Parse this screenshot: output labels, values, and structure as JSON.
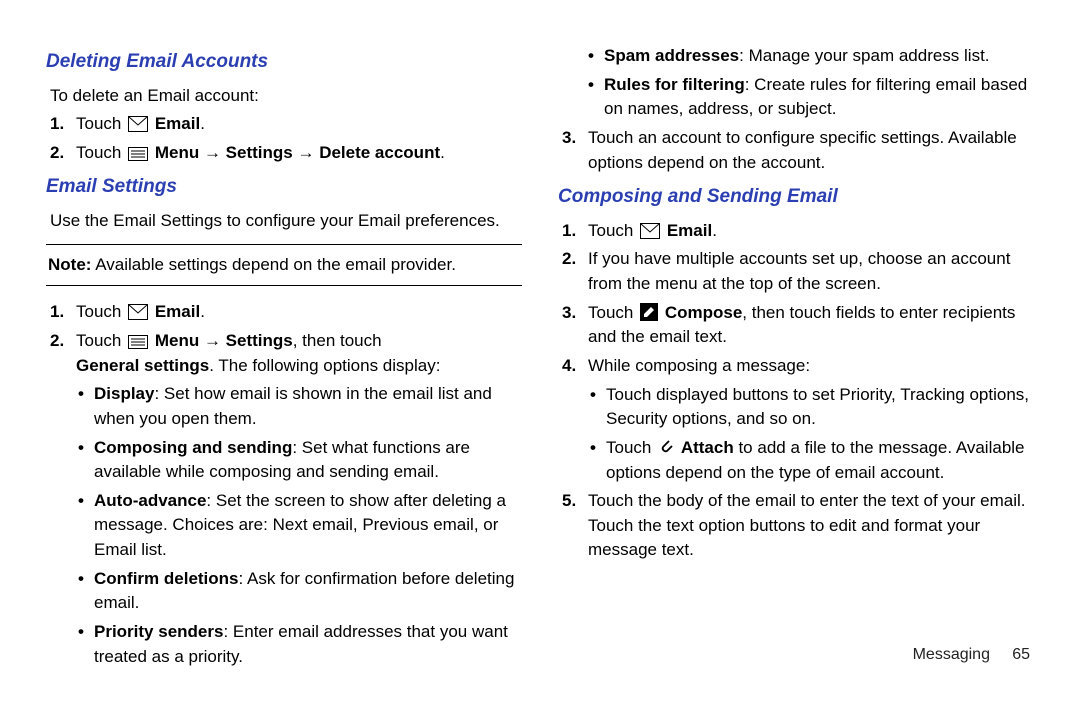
{
  "footer": {
    "section": "Messaging",
    "page": "65"
  },
  "left": {
    "h1": "Deleting Email Accounts",
    "intro1": "To delete an Email account:",
    "s1_touch": "Touch ",
    "s1_email": "Email",
    "s1_dot": ".",
    "s2_touch": "Touch ",
    "s2_menu": "Menu",
    "s2_settings": "Settings",
    "s2_delete": "Delete account",
    "s2_dot": ".",
    "h2": "Email Settings",
    "intro2": "Use the Email Settings to configure your Email preferences.",
    "note_b": "Note:",
    "note_t": " Available settings depend on the email provider.",
    "s3_touch": "Touch ",
    "s3_email": "Email",
    "s3_dot": ".",
    "s4_touch": "Touch ",
    "s4_menu": "Menu",
    "s4_settings": "Settings",
    "s4_then": ", then touch ",
    "s4_general": "General settings",
    "s4_rest": ". The following options display:",
    "b_display_b": "Display",
    "b_display_t": ": Set how email is shown in the email list and when you open them.",
    "b_comp_b": "Composing and sending",
    "b_comp_t": ": Set what functions are available while composing and sending email.",
    "b_auto_b": "Auto-advance",
    "b_auto_t": ": Set the screen to show after deleting a message. Choices are: Next email, Previous email, or Email list.",
    "b_conf_b": "Confirm deletions",
    "b_conf_t": ": Ask for confirmation before deleting email.",
    "b_prio_b": "Priority senders",
    "b_prio_t": ": Enter email addresses that you want treated as a priority."
  },
  "right": {
    "b_spam_b": "Spam addresses",
    "b_spam_t": ": Manage your spam address list.",
    "b_rules_b": "Rules for filtering",
    "b_rules_t": ": Create rules for filtering email based on names, address, or subject.",
    "s3_text1": "Touch an account to configure specific settings. Available options depend on the account.",
    "h3": "Composing and Sending Email",
    "c1_touch": "Touch ",
    "c1_email": "Email",
    "c1_dot": ".",
    "c2_text": "If you have multiple accounts set up, choose an account from the menu at the top of the screen.",
    "c3_touch": "Touch ",
    "c3_compose": "Compose",
    "c3_rest": ", then touch fields to enter recipients and the email text.",
    "c4_text": "While composing a message:",
    "c4_b1": "Touch displayed buttons to set Priority, Tracking options, Security options, and so on.",
    "c4_b2_pre": "Touch ",
    "c4_b2_attach": "Attach",
    "c4_b2_post": " to add a file to the message. Available options depend on the type of email account.",
    "c5_text": "Touch the body of the email to enter the text of your email. Touch the text option buttons to edit and format your message text."
  }
}
